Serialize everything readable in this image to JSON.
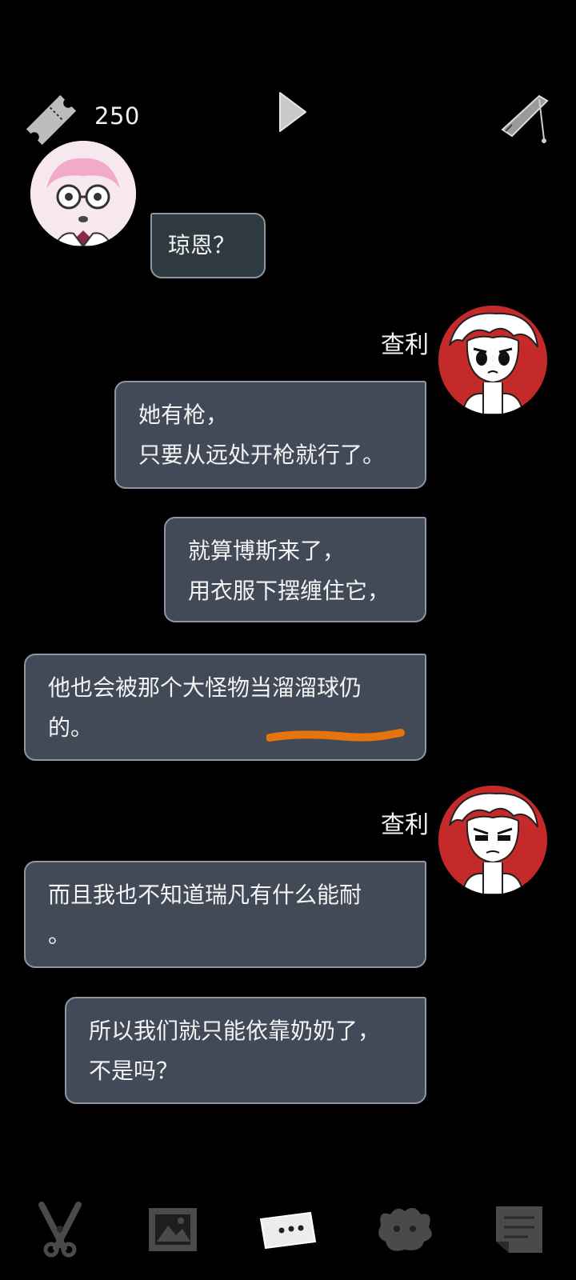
{
  "top_bar": {
    "ticket_icon": "ticket-icon",
    "ticket_count": "250",
    "play_icon": "play-icon",
    "quill_icon": "quill-icon"
  },
  "chat": {
    "messages": [
      {
        "sender": "",
        "avatar": "glasses-girl-avatar",
        "text": "琼恩？"
      },
      {
        "sender": "查利",
        "avatar": "charlie-avatar",
        "lines": [
          "她有枪，",
          "只要从远处开枪就行了。"
        ]
      },
      {
        "sender": "",
        "lines": [
          "就算博斯来了，",
          "用衣服下摆缠住它，"
        ]
      },
      {
        "sender": "",
        "lines": [
          "他也会被那个大怪物当溜溜球仍",
          "的。"
        ],
        "highlight_color": "#e8720c"
      },
      {
        "sender": "查利",
        "avatar": "charlie-avatar",
        "lines": [
          "而且我也不知道瑞凡有什么能耐",
          "。"
        ]
      },
      {
        "sender": "",
        "lines": [
          "所以我们就只能依靠奶奶了，",
          "不是吗？"
        ]
      }
    ]
  },
  "bottom_nav": {
    "items": [
      "scissors-icon",
      "gallery-icon",
      "chat-icon",
      "monster-icon",
      "notes-icon"
    ],
    "active": "chat-icon"
  },
  "colors": {
    "background": "#000000",
    "bubble": "#424a58",
    "bubble_border": "#8e96a2",
    "avatar_red": "#c42a2a",
    "underline": "#e8720c"
  }
}
